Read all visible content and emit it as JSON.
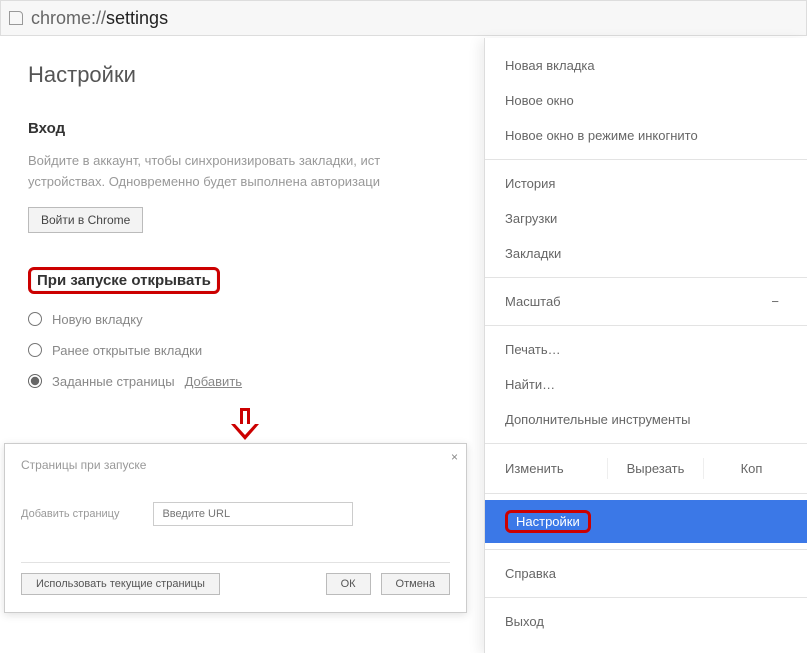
{
  "url": {
    "prefix": "chrome://",
    "path": "settings"
  },
  "page": {
    "title": "Настройки"
  },
  "signin": {
    "heading": "Вход",
    "body_line1": "Войдите в аккаунт, чтобы синхронизировать закладки, ист",
    "body_line2": "устройствах. Одновременно будет выполнена авторизаци",
    "button": "Войти в Chrome"
  },
  "startup": {
    "heading": "При запуске открывать",
    "options": [
      "Новую вкладку",
      "Ранее открытые вкладки",
      "Заданные страницы"
    ],
    "add_link": "Добавить"
  },
  "dialog": {
    "title": "Страницы при запуске",
    "add_label": "Добавить страницу",
    "placeholder": "Введите URL",
    "use_current": "Использовать текущие страницы",
    "ok": "ОК",
    "cancel": "Отмена",
    "close": "×"
  },
  "menu": {
    "new_tab": "Новая вкладка",
    "new_window": "Новое окно",
    "new_incognito": "Новое окно в режиме инкогнито",
    "history": "История",
    "downloads": "Загрузки",
    "bookmarks": "Закладки",
    "zoom": "Масштаб",
    "print": "Печать…",
    "find": "Найти…",
    "more_tools": "Дополнительные инструменты",
    "edit_label": "Изменить",
    "cut": "Вырезать",
    "copy": "Коп",
    "settings": "Настройки",
    "help": "Справка",
    "exit": "Выход"
  }
}
